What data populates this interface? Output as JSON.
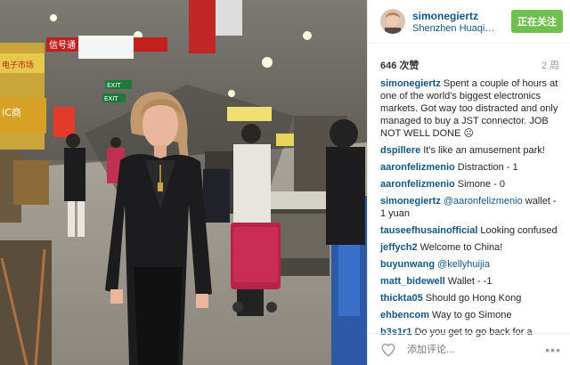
{
  "header": {
    "username": "simonegiertz",
    "location": "Shenzhen Huaqiangbei",
    "follow_label": "正在关注"
  },
  "stats": {
    "likes": "646 次赞",
    "age": "2 周"
  },
  "caption": {
    "user": "simonegiertz",
    "text": "Spent a couple of hours at one of the world's biggest electronics markets. Got way too distracted and only managed to buy a JST connector. JOB NOT WELL DONE ☹"
  },
  "comments": [
    {
      "user": "dspillere",
      "text": "It's like an amusement park!"
    },
    {
      "user": "aaronfelizmenio",
      "text": "Distraction - 1"
    },
    {
      "user": "aaronfelizmenio",
      "text": "Simone - 0"
    },
    {
      "user": "simonegiertz",
      "mention": "@aaronfelizmenio",
      "text": "wallet - 1 yuan"
    },
    {
      "user": "tauseefhusainofficial",
      "text": "Looking confused"
    },
    {
      "user": "jeffych2",
      "text": "Welcome to China!"
    },
    {
      "user": "buyunwang",
      "mention": "@kellyhuijia",
      "text": ""
    },
    {
      "user": "matt_bidewell",
      "text": "Wallet - -1"
    },
    {
      "user": "thickta05",
      "text": "Should go Hong Kong"
    },
    {
      "user": "ehbencom",
      "text": "Way to go Simone"
    },
    {
      "user": "b3s1r1",
      "text": "Do you get to go back for a second round?"
    }
  ],
  "footer": {
    "add_comment_placeholder": "添加评论...",
    "more": "•••"
  },
  "photo_signs": {
    "sign1": "信号通",
    "sign2": "电子市场",
    "sign3": "IC商",
    "exit1": "EXIT",
    "exit2": "EXIT"
  },
  "colors": {
    "link": "#125688",
    "follow_button": "#70c050"
  }
}
